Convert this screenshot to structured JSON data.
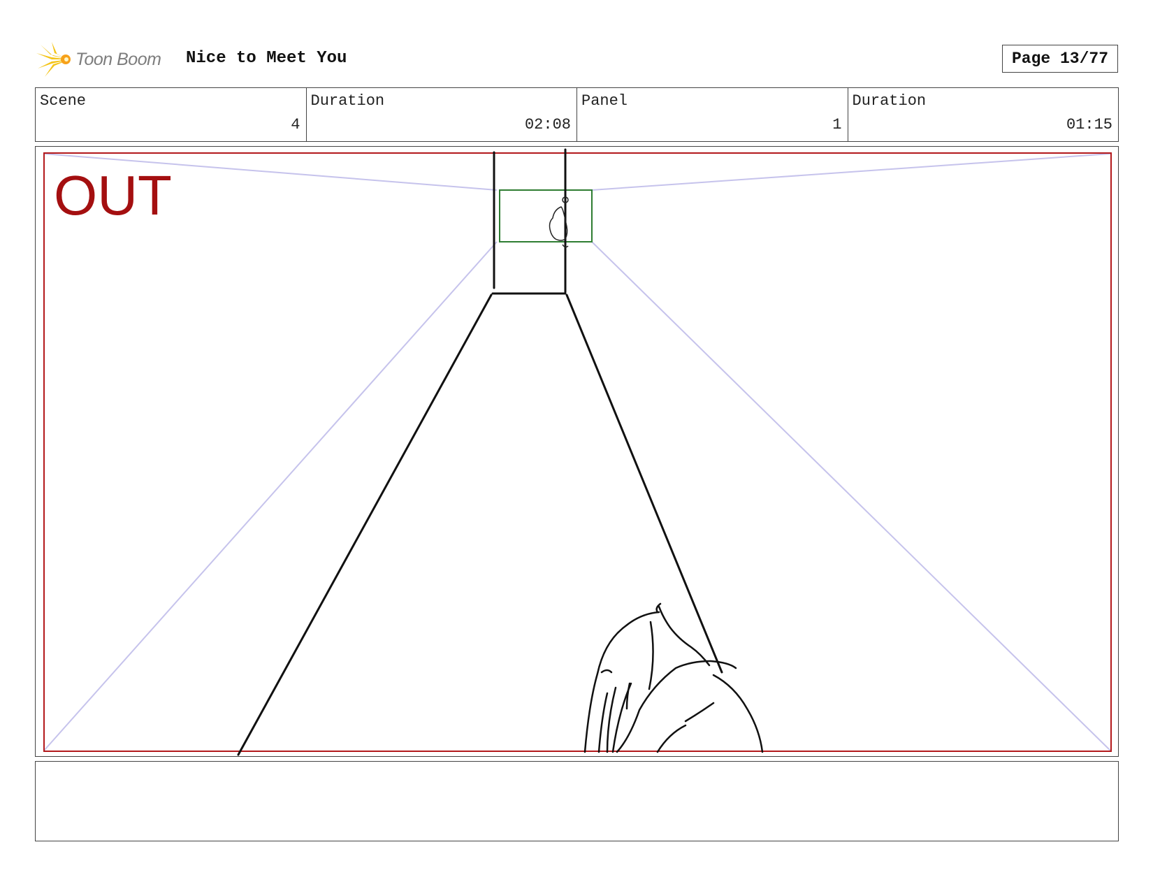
{
  "header": {
    "logo_text": "Toon Boom",
    "title": "Nice to Meet You",
    "page": "Page 13/77"
  },
  "info": {
    "scene_label": "Scene",
    "scene_value": "4",
    "scene_duration_label": "Duration",
    "scene_duration_value": "02:08",
    "panel_label": "Panel",
    "panel_value": "1",
    "panel_duration_label": "Duration",
    "panel_duration_value": "01:15"
  },
  "panel": {
    "camera_label": "OUT",
    "frame_color": "#b3191c",
    "inner_frame_color": "#2e7d32",
    "guide_color": "#c6c3ec"
  },
  "notes": {
    "text": ""
  }
}
